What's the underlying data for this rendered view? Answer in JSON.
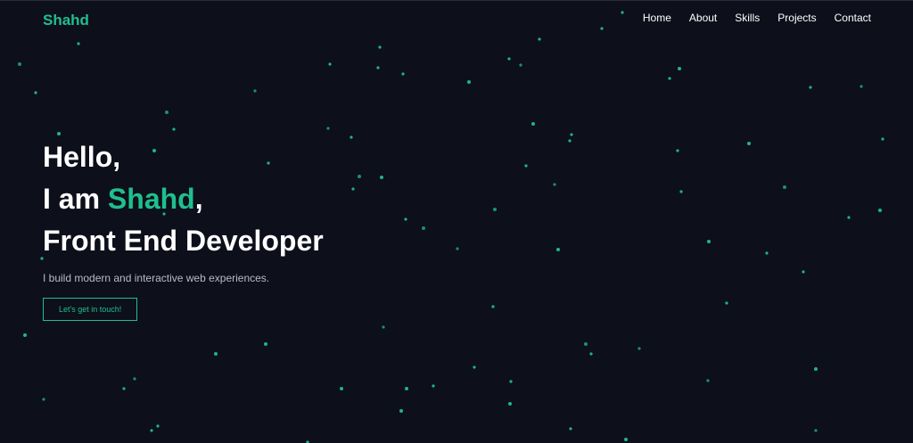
{
  "nav": {
    "logo": "Shahd",
    "links": [
      "Home",
      "About",
      "Skills",
      "Projects",
      "Contact"
    ]
  },
  "hero": {
    "line1": "Hello,",
    "line2_prefix": "I am ",
    "line2_name": "Shahd",
    "line2_suffix": ",",
    "line3": "Front End Developer",
    "tagline": "I build modern and interactive web experiences.",
    "cta_label": "Let's get in touch!"
  },
  "colors": {
    "background": "#0d0f1a",
    "accent": "#1fbf8f",
    "text": "#ffffff",
    "muted": "#b8bcc8"
  }
}
